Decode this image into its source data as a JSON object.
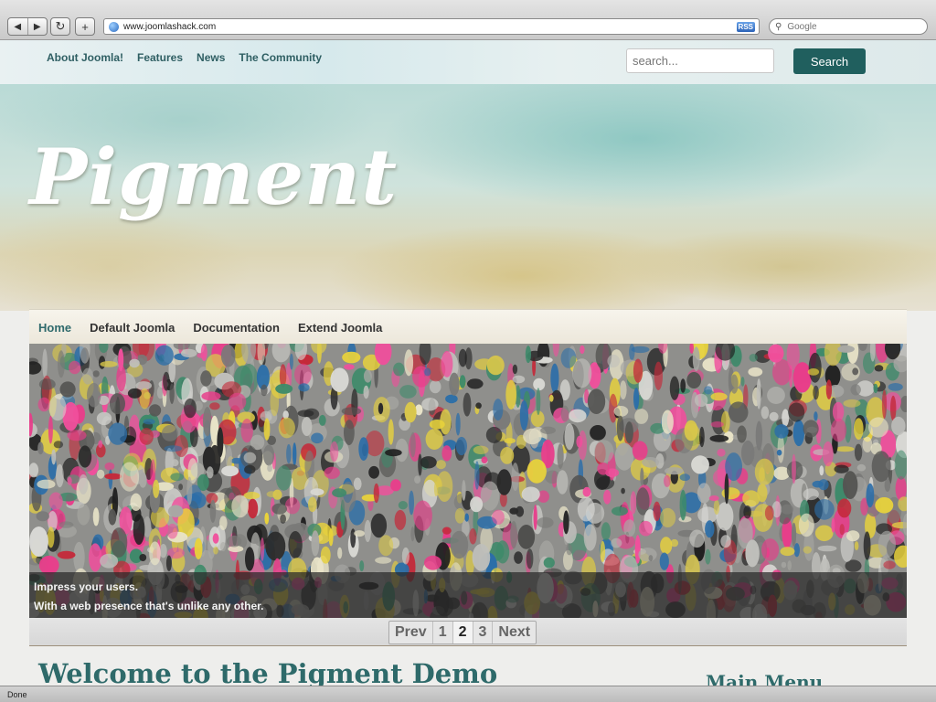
{
  "browser": {
    "url": "www.joomlashack.com",
    "rss_label": "RSS",
    "search_placeholder": "Google",
    "status": "Done",
    "back_glyph": "◀",
    "forward_glyph": "▶",
    "reload_glyph": "↻",
    "add_glyph": "+"
  },
  "topnav": {
    "items": [
      "About Joomla!",
      "Features",
      "News",
      "The Community"
    ]
  },
  "site_search": {
    "placeholder": "search...",
    "button": "Search"
  },
  "logo": "Pigment",
  "mainnav": {
    "items": [
      "Home",
      "Default Joomla",
      "Documentation",
      "Extend Joomla"
    ],
    "active": "Home"
  },
  "slideshow": {
    "caption_line1": "Impress your users.",
    "caption_line2": "With a web presence that's unlike any other.",
    "pager": {
      "prev": "Prev",
      "pages": [
        "1",
        "2",
        "3"
      ],
      "current": "2",
      "next": "Next"
    }
  },
  "content": {
    "title": "Welcome to the Pigment Demo"
  },
  "sidebar": {
    "title": "Main Menu"
  },
  "colors": {
    "accent": "#205f5e",
    "link": "#2f5f63"
  }
}
